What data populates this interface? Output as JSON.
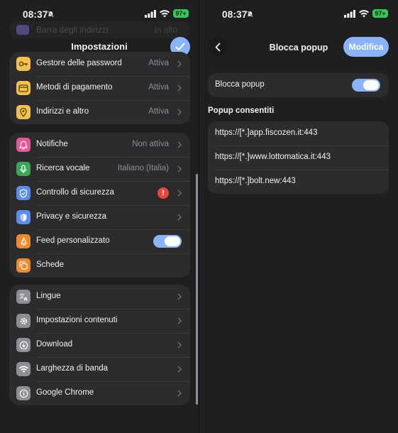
{
  "status_bar": {
    "time": "08:37",
    "battery": "97+"
  },
  "settings": {
    "title": "Impostazioni",
    "partial_row": {
      "label": "Barra degli indirizzi",
      "value": "In alto"
    },
    "groups": [
      [
        {
          "label": "Gestore delle password",
          "value": "Attiva",
          "icon": "key-icon",
          "color": "#f2c14e"
        },
        {
          "label": "Metodi di pagamento",
          "value": "Attiva",
          "icon": "credit-card-icon",
          "color": "#f2c14e"
        },
        {
          "label": "Indirizzi e altro",
          "value": "Attiva",
          "icon": "location-pin-icon",
          "color": "#f2c14e"
        }
      ],
      [
        {
          "label": "Notifiche",
          "value": "Non attiva",
          "icon": "bell-icon",
          "color": "#e8569a"
        },
        {
          "label": "Ricerca vocale",
          "value": "Italiano (Italia)",
          "icon": "microphone-icon",
          "color": "#3aa757"
        },
        {
          "label": "Controllo di sicurezza",
          "value": "",
          "icon": "shield-check-icon",
          "color": "#5b8def",
          "alert": "!"
        },
        {
          "label": "Privacy e sicurezza",
          "value": "",
          "icon": "shield-icon",
          "color": "#5b8def"
        },
        {
          "label": "Feed personalizzato",
          "value": "",
          "icon": "flame-icon",
          "color": "#ef8a2c",
          "toggle": true
        },
        {
          "label": "Schede",
          "value": "",
          "icon": "tabs-icon",
          "color": "#ef8a2c"
        }
      ],
      [
        {
          "label": "Lingue",
          "value": "",
          "icon": "translate-icon",
          "color": "#8e8e93"
        },
        {
          "label": "Impostazioni contenuti",
          "value": "",
          "icon": "gear-icon",
          "color": "#8e8e93"
        },
        {
          "label": "Download",
          "value": "",
          "icon": "download-icon",
          "color": "#8e8e93"
        },
        {
          "label": "Larghezza di banda",
          "value": "",
          "icon": "wifi-icon",
          "color": "#8e8e93"
        },
        {
          "label": "Google Chrome",
          "value": "",
          "icon": "info-icon",
          "color": "#8e8e93"
        }
      ]
    ]
  },
  "popup": {
    "title": "Blocca popup",
    "edit_label": "Modifica",
    "toggle_label": "Blocca popup",
    "toggle_on": true,
    "section_title": "Popup consentiti",
    "allowed": [
      "https://[*.]app.fiscozen.it:443",
      "https://[*.]www.lottomatica.it:443",
      "https://[*.]bolt.new:443"
    ]
  },
  "colors": {
    "accent": "#8ab4f8",
    "background": "#1f1f21",
    "card": "#2c2c2e",
    "alert": "#e5483f"
  }
}
